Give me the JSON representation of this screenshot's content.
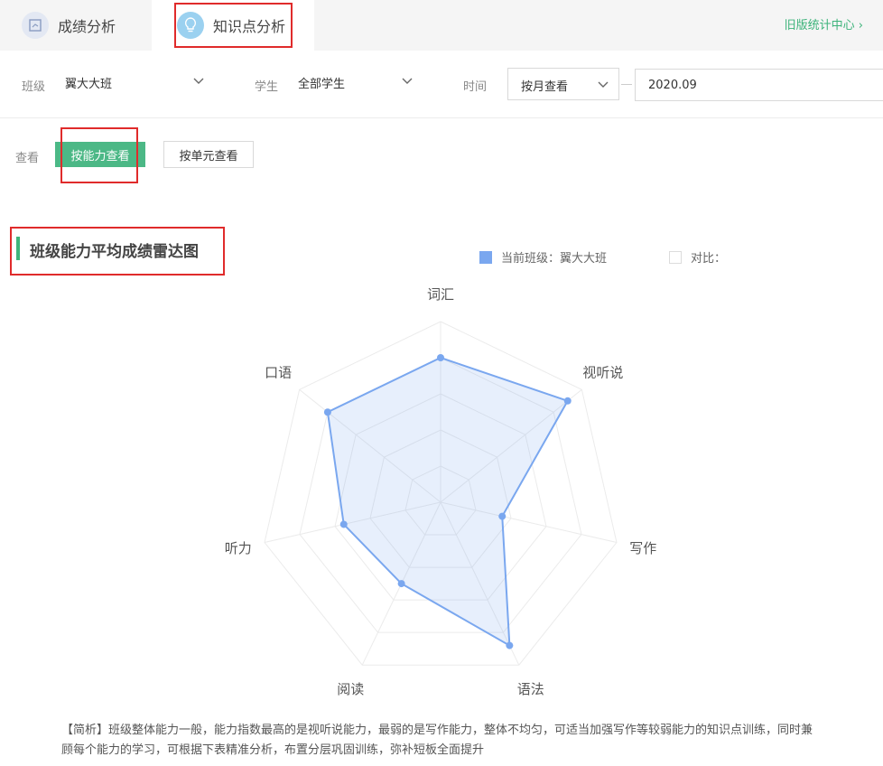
{
  "tabs": [
    {
      "label": "成绩分析",
      "icon": "report-icon"
    },
    {
      "label": "知识点分析",
      "icon": "lightbulb-icon"
    }
  ],
  "old_stats_link": "旧版统计中心",
  "filters": {
    "class_label": "班级",
    "class_value": "翼大大班",
    "student_label": "学生",
    "student_value": "全部学生",
    "time_label": "时间",
    "time_mode": "按月查看",
    "date_value": "2020.09"
  },
  "view": {
    "label": "查看",
    "by_ability": "按能力查看",
    "by_unit": "按单元查看"
  },
  "section_title": "班级能力平均成绩雷达图",
  "legend": {
    "current": "当前班级：翼大大班",
    "compare": "对比："
  },
  "colors": {
    "accent_green": "#4cb886",
    "series_blue": "#7aa7ef",
    "highlight_red": "#e02b2b"
  },
  "chart_data": {
    "type": "radar",
    "axes": [
      "词汇",
      "视听说",
      "写作",
      "语法",
      "阅读",
      "听力",
      "口语"
    ],
    "max": 100,
    "series": [
      {
        "name": "当前班级：翼大大班",
        "values": [
          80,
          90,
          35,
          88,
          50,
          55,
          80
        ]
      }
    ]
  },
  "analysis": "【简析】班级整体能力一般，能力指数最高的是视听说能力，最弱的是写作能力，整体不均匀，可适当加强写作等较弱能力的知识点训练，同时兼顾每个能力的学习，可根据下表精准分析，布置分层巩固训练，弥补短板全面提升"
}
